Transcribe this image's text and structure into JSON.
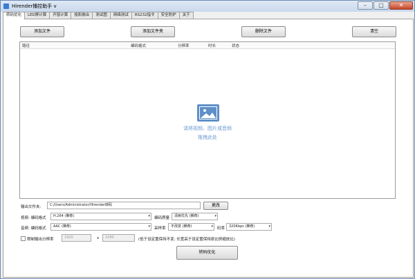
{
  "window": {
    "title": "Hirender播控助手 v"
  },
  "tabs": [
    "转码优化",
    "LED屏计算",
    "开窗计算",
    "投影融合",
    "测试图",
    "网络测试",
    "RS232指令",
    "安全防护",
    "关于"
  ],
  "toolbar": {
    "add_file": "添加文件",
    "add_folder": "添加文件夹",
    "delete_file": "删除文件",
    "clear": "清空"
  },
  "table": {
    "headers": {
      "path": "路径",
      "codec": "编码格式",
      "resolution": "分辨率",
      "duration": "时长",
      "status": "状态"
    },
    "drop_hint_line1": "请将视频、图片或音频",
    "drop_hint_line2": "拖拽此处"
  },
  "output": {
    "folder_label": "输出文件夹:",
    "folder_value": "C:/Users/Administrator/Hirender转码",
    "change_button": "更改"
  },
  "video": {
    "label": "视频: 编码格式",
    "codec_value": "H.264 (推荐)",
    "quality_label": "编码质量",
    "quality_value": "清晰优先 (推荐)"
  },
  "audio": {
    "label": "音频: 编码格式",
    "codec_value": "AAC (推荐)",
    "samplerate_label": "采样率",
    "samplerate_value": "不改变 (推荐)",
    "bitrate_label": "码率",
    "bitrate_value": "320Kbps (推荐)"
  },
  "resolution": {
    "checkbox_label": "限制输出分辨率",
    "width_value": "1920",
    "x_separator": "x",
    "height_value": "1080",
    "note": "(低于设定置保持不变; 长宽高于设定置保持原比例缩放比)"
  },
  "action": {
    "convert_button": "转码优化"
  },
  "colors": {
    "accent": "#5f8fc8",
    "hint": "#6e9ad2"
  }
}
